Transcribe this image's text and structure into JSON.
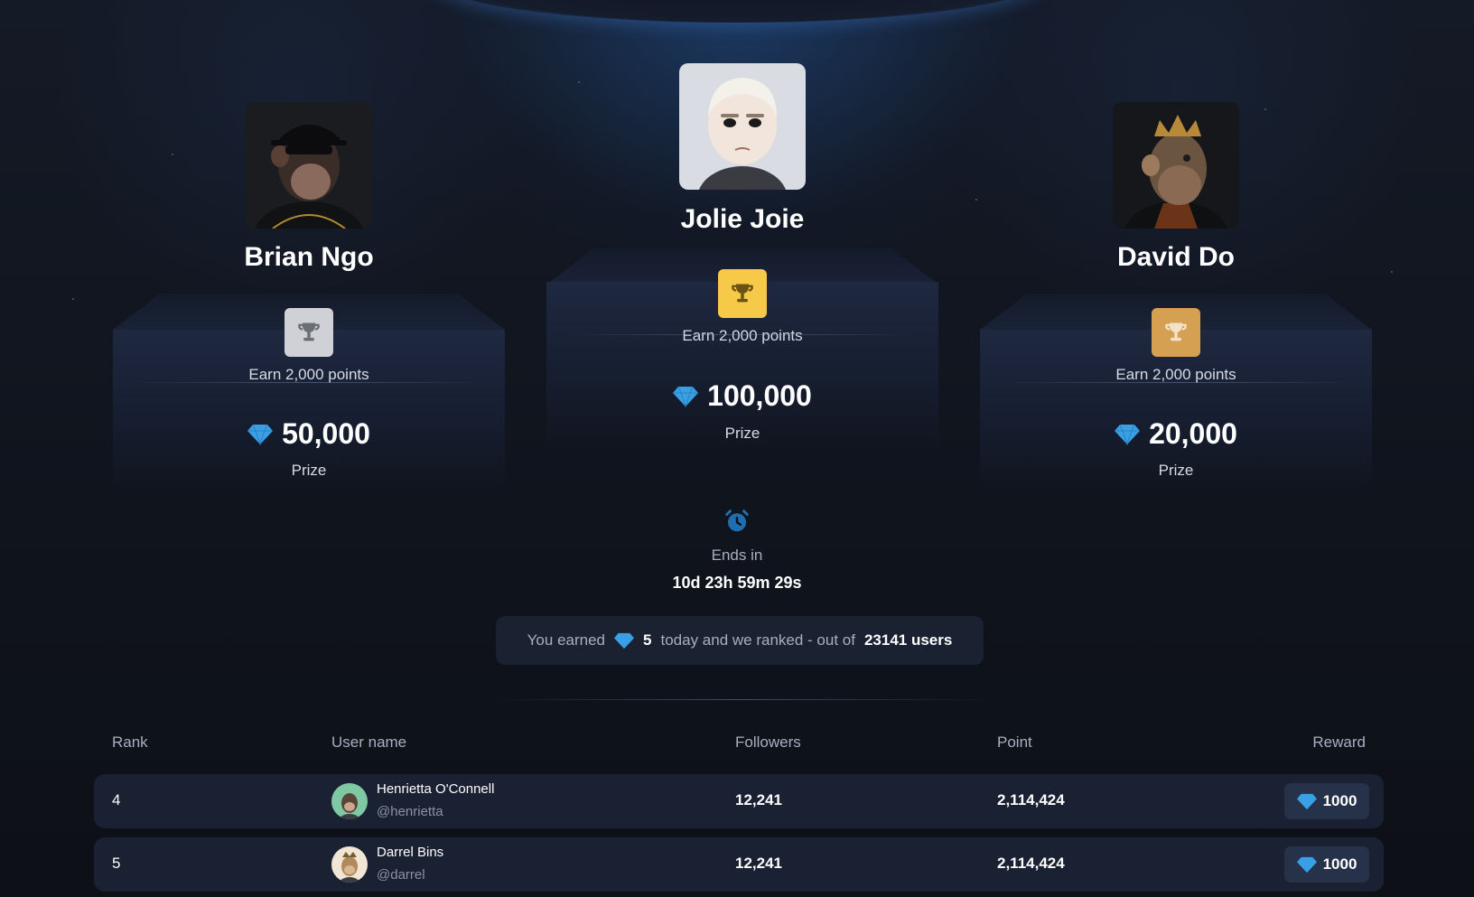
{
  "podium": {
    "second": {
      "name": "Brian Ngo",
      "earn": "Earn 2,000 points",
      "prize": "50,000",
      "prize_label": "Prize",
      "trophy_color": "#cfd1d6",
      "avatar": "bored-ape-avatar"
    },
    "first": {
      "name": "Jolie Joie",
      "earn": "Earn 2,000 points",
      "prize": "100,000",
      "prize_label": "Prize",
      "trophy_color": "#f7c948",
      "avatar": "cartoon-character-avatar"
    },
    "third": {
      "name": "David Do",
      "earn": "Earn 2,000 points",
      "prize": "20,000",
      "prize_label": "Prize",
      "trophy_color": "#d5a052",
      "avatar": "crowned-ape-avatar"
    }
  },
  "countdown": {
    "label": "Ends in",
    "time": "10d 23h 59m 29s"
  },
  "earned": {
    "prefix": "You earned",
    "amount": "5",
    "middle": "today and we ranked - out of",
    "total": "23141 users"
  },
  "table": {
    "headers": {
      "rank": "Rank",
      "username": "User name",
      "followers": "Followers",
      "point": "Point",
      "reward": "Reward"
    },
    "rows": [
      {
        "rank": "4",
        "name": "Henrietta O'Connell",
        "handle": "@henrietta",
        "followers": "12,241",
        "point": "2,114,424",
        "reward": "1000"
      },
      {
        "rank": "5",
        "name": "Darrel Bins",
        "handle": "@darrel",
        "followers": "12,241",
        "point": "2,114,424",
        "reward": "1000"
      }
    ]
  },
  "colors": {
    "accent_gem": "#3aa0e6",
    "background": "#0e1118"
  }
}
